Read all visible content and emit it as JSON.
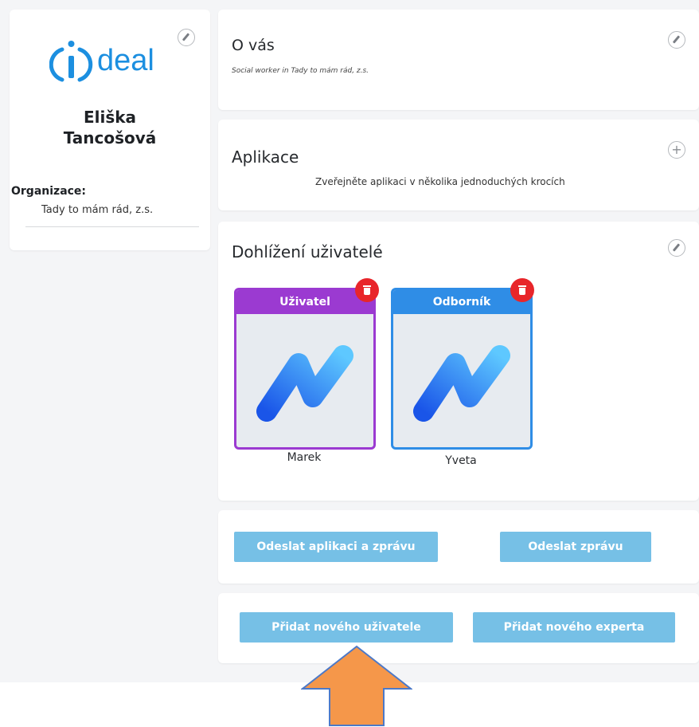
{
  "logo": {
    "text": "deal",
    "accent": "#1c8fe0"
  },
  "user": {
    "name_line1": "Eliška",
    "name_line2": "Tancošová"
  },
  "organization": {
    "label": "Organizace:",
    "value": "Tady to mám rád, z.s."
  },
  "about": {
    "title": "O vás",
    "text": "Social worker in Tady to mám rád, z.s."
  },
  "apps": {
    "title": "Aplikace",
    "hint": "Zveřejněte aplikaci v několika jednoduchých krocích"
  },
  "supervised": {
    "title": "Dohlížení uživatelé",
    "cards": [
      {
        "role": "Uživatel",
        "name": "Marek",
        "color": "#9b3ad1"
      },
      {
        "role": "Odborník",
        "name": "Yveta",
        "color": "#2f8de6"
      }
    ]
  },
  "actions": {
    "send_app_msg": "Odeslat aplikaci a zprávu",
    "send_msg": "Odeslat zprávu",
    "add_user": "Přidat nového uživatele",
    "add_expert": "Přidat nového experta"
  },
  "colors": {
    "button_bg": "#76c0e6",
    "arrow": "#f5974a",
    "delete": "#e8252a"
  },
  "icons": [
    "pencil-icon",
    "plus-icon",
    "trash-icon",
    "arrow-up-icon",
    "ideal-logo"
  ]
}
